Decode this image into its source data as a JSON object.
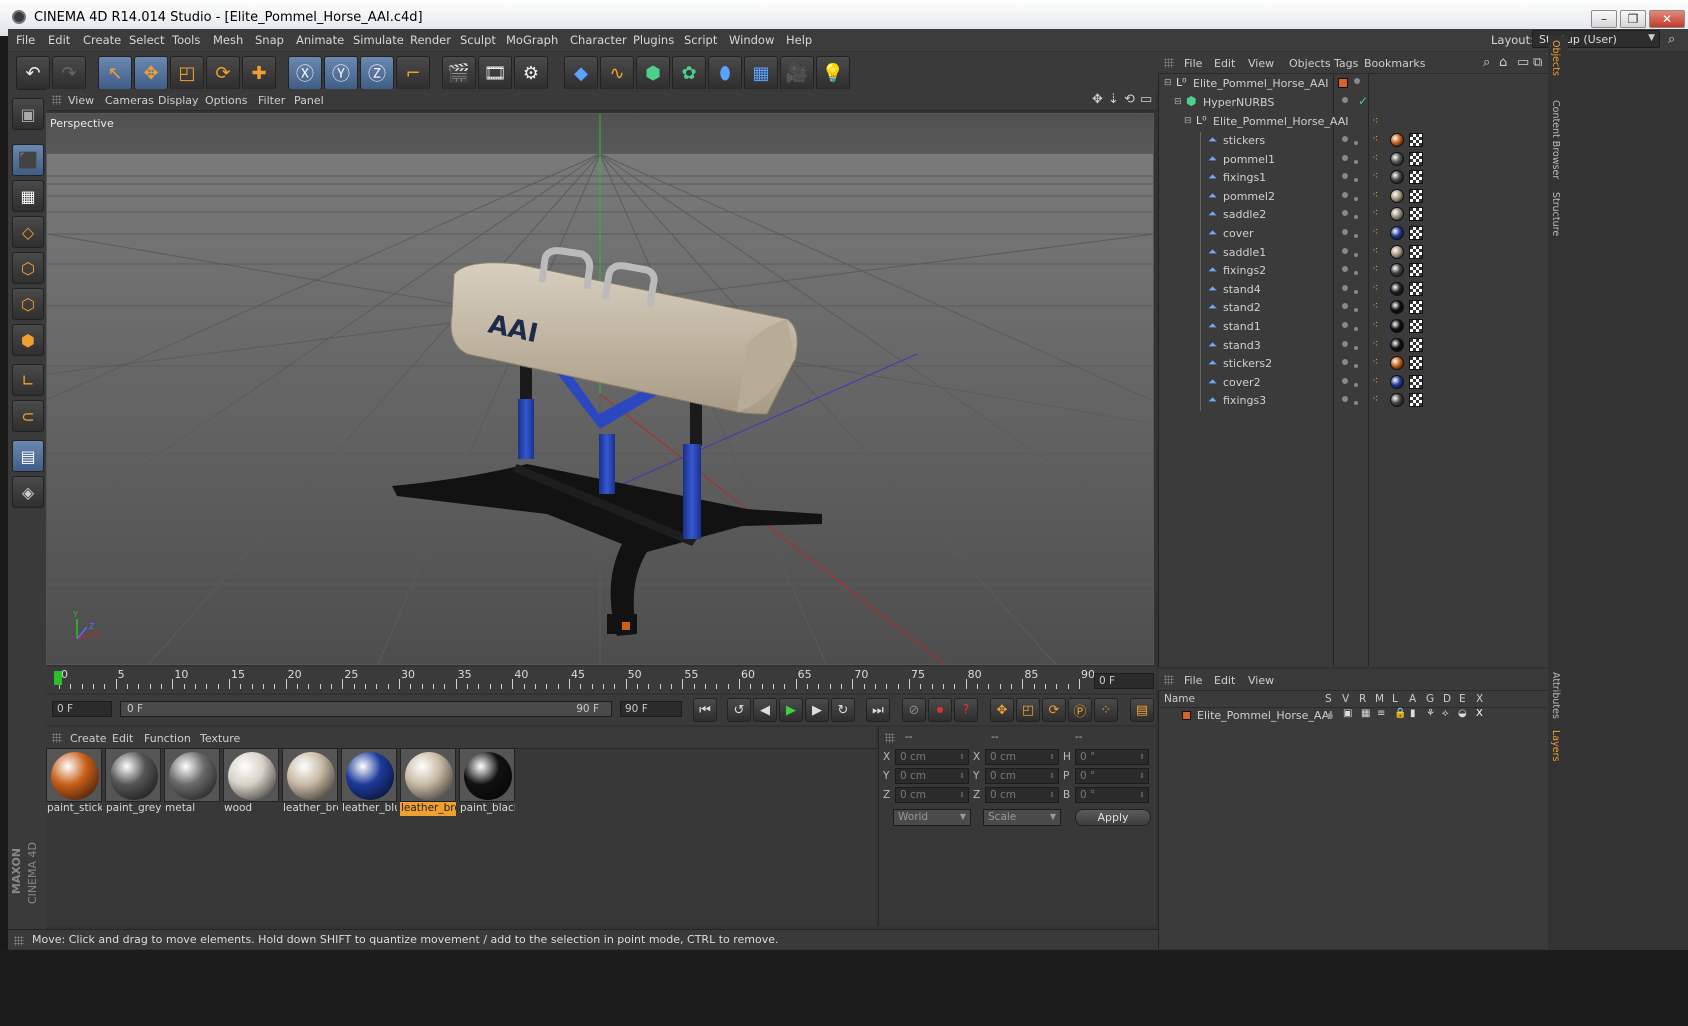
{
  "window": {
    "title": "CINEMA 4D R14.014 Studio - [Elite_Pommel_Horse_AAI.c4d]"
  },
  "menu": [
    "File",
    "Edit",
    "Create",
    "Select",
    "Tools",
    "Mesh",
    "Snap",
    "Animate",
    "Simulate",
    "Render",
    "Sculpt",
    "MoGraph",
    "Character",
    "Plugins",
    "Script",
    "Window",
    "Help"
  ],
  "layout": {
    "label": "Layout:",
    "value": "Startup (User)"
  },
  "viewport": {
    "menu": [
      "View",
      "Cameras",
      "Display",
      "Options",
      "Filter",
      "Panel"
    ],
    "name": "Perspective",
    "logo_text": "AAI",
    "axis": {
      "y": "Y",
      "x": "X",
      "z": "Z"
    }
  },
  "object_manager": {
    "menu": [
      "File",
      "Edit",
      "View",
      "Objects",
      "Tags",
      "Bookmarks"
    ],
    "root": "Elite_Pommel_Horse_AAI",
    "hypernurbs": "HyperNURBS",
    "group": "Elite_Pommel_Horse_AAI",
    "children": [
      "stickers",
      "pommel1",
      "fixings1",
      "pommel2",
      "saddle2",
      "cover",
      "saddle1",
      "fixings2",
      "stand4",
      "stand2",
      "stand1",
      "stand3",
      "stickers2",
      "cover2",
      "fixings3"
    ],
    "child_colors": [
      "#c8601a",
      "#555555",
      "#444444",
      "#a89880",
      "#9a8f80",
      "#1d3a9a",
      "#a89880",
      "#444444",
      "#222222",
      "#111111",
      "#111111",
      "#111111",
      "#c8601a",
      "#1d3a9a",
      "#444444"
    ]
  },
  "side_tabs": {
    "objects": "Objects",
    "content_browser": "Content Browser",
    "structure": "Structure",
    "attributes": "Attributes",
    "layers": "Layers"
  },
  "timeline": {
    "ticks": [
      "0",
      "5",
      "10",
      "15",
      "20",
      "25",
      "30",
      "35",
      "40",
      "45",
      "50",
      "55",
      "60",
      "65",
      "70",
      "75",
      "80",
      "85",
      "90"
    ],
    "current_frame": "0 F",
    "start_field": "0 F",
    "slider_start": "0 F",
    "slider_end": "90 F",
    "end_field": "90 F"
  },
  "material_manager": {
    "menu": [
      "Create",
      "Edit",
      "Function",
      "Texture"
    ],
    "materials": [
      {
        "name": "paint_stick",
        "color": "#c8601a"
      },
      {
        "name": "paint_grey",
        "color": "#555555"
      },
      {
        "name": "metal",
        "color": "#6a6a6a"
      },
      {
        "name": "wood",
        "color": "#d8d2c8"
      },
      {
        "name": "leather_brc",
        "color": "#c9bba5"
      },
      {
        "name": "leather_blu",
        "color": "#1d3a9a"
      },
      {
        "name": "leather_brc",
        "color": "#c9bba5"
      },
      {
        "name": "paint_black",
        "color": "#111111"
      }
    ],
    "selected_index": 6
  },
  "coordinates": {
    "headers": [
      "--",
      "--",
      "--"
    ],
    "rows": [
      {
        "l1": "X",
        "v1": "0 cm",
        "l2": "X",
        "v2": "0 cm",
        "l3": "H",
        "v3": "0 °"
      },
      {
        "l1": "Y",
        "v1": "0 cm",
        "l2": "Y",
        "v2": "0 cm",
        "l3": "P",
        "v3": "0 °"
      },
      {
        "l1": "Z",
        "v1": "0 cm",
        "l2": "Z",
        "v2": "0 cm",
        "l3": "B",
        "v3": "0 °"
      }
    ],
    "mode1": "World",
    "mode2": "Scale",
    "apply": "Apply"
  },
  "layer_manager": {
    "menu": [
      "File",
      "Edit",
      "View"
    ],
    "columns": [
      "Name",
      "S",
      "V",
      "R",
      "M",
      "L",
      "A",
      "G",
      "D",
      "E",
      "X"
    ],
    "item": "Elite_Pommel_Horse_AAI"
  },
  "brand": {
    "maxon": "MAXON",
    "product": "CINEMA 4D"
  },
  "status": "Move: Click and drag to move elements. Hold down SHIFT to quantize movement / add to the selection in point mode, CTRL to remove."
}
